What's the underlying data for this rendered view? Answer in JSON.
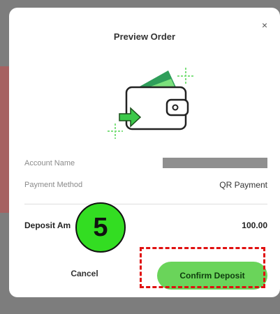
{
  "modal": {
    "title": "Preview Order",
    "close_glyph": "×"
  },
  "icons": {
    "illustration": "wallet-icon",
    "close": "close-icon"
  },
  "details": {
    "account_label": "Account Name",
    "account_value": "",
    "method_label": "Payment Method",
    "method_value": "QR Payment",
    "amount_label": "Deposit Am",
    "amount_value": "100.00"
  },
  "actions": {
    "cancel_label": "Cancel",
    "confirm_label": "Confirm Deposit"
  },
  "annotation": {
    "step_number": "5"
  },
  "colors": {
    "accent": "#6ad45a",
    "highlight": "#e01010",
    "badge": "#33dd22"
  }
}
